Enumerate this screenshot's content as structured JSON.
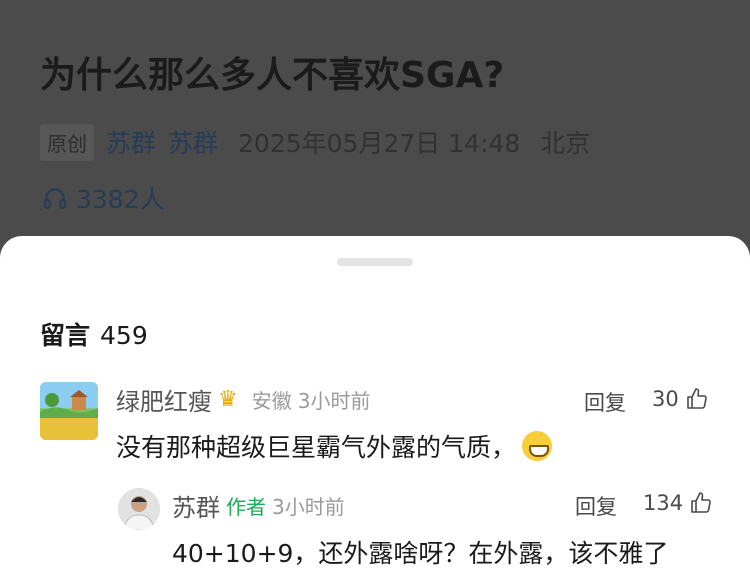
{
  "article": {
    "title": "为什么那么多人不喜欢SGA?",
    "original_tag": "原创",
    "author_1": "苏群",
    "author_2": "苏群",
    "date": "2025年05月27日 14:48",
    "location": "北京",
    "listeners": "3382人"
  },
  "comments_section": {
    "label": "留言",
    "count": "459"
  },
  "comments": [
    {
      "user": "绿肥红瘦",
      "badge_icon": "crown-icon",
      "location": "安徽",
      "time": "3小时前",
      "reply_label": "回复",
      "likes": "30",
      "text": "没有那种超级巨星霸气外露的气质，",
      "emoji": "grinning-emoji-icon"
    },
    {
      "user": "苏群",
      "author_badge": "作者",
      "time": "3小时前",
      "reply_label": "回复",
      "likes": "134",
      "text": "40+10+9，还外露啥呀？在外露，该不雅了"
    }
  ]
}
